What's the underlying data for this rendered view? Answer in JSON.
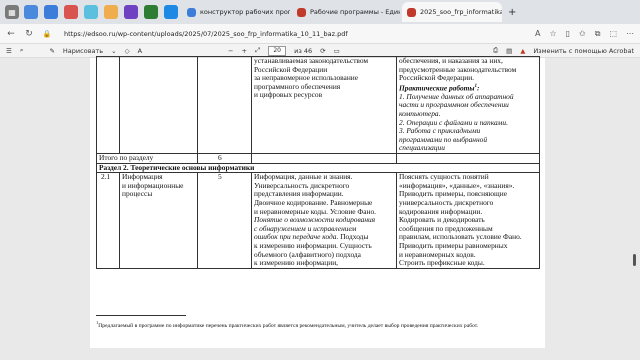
{
  "browser": {
    "tabs": [
      {
        "title": "конструктор рабочих программ"
      },
      {
        "title": "Рабочие программы - Единое"
      },
      {
        "title": "2025_soo_frp_informatika_10_11..."
      }
    ],
    "url": "https://edsoo.ru/wp-content/uploads/2025/07/2025_soo_frp_informatika_10_11_baz.pdf"
  },
  "pdf_toolbar": {
    "draw_label": "Нарисовать",
    "page_current": "20",
    "page_total": "из 46",
    "acrobat_label": "Изменить с помощью Acrobat"
  },
  "table": {
    "r1_c3": [
      "устанавливаемая законодательством",
      "Российской Федерации",
      "за неправомерное использование",
      "программного обеспечения",
      "и цифровых ресурсов"
    ],
    "r1_c4_top": [
      "обеспечения, и наказания за них,",
      "предусмотренные законодательством",
      "Российской Федерации."
    ],
    "practice_heading": "Практические работы",
    "practice_sup": "1",
    "practice_items": [
      "1. Получение данных об аппаратной",
      "части и программном обеспечении",
      "компьютера.",
      "2. Операции с файлами и папками.",
      "3. Работа с прикладными",
      "программами по выбранной",
      "специализации"
    ],
    "total_label": "Итого по разделу",
    "total_value": "6",
    "section_title": "Раздел 2. Теоретические основы информатики",
    "r3_num": "2.1",
    "r3_topic": [
      "Информация",
      "и информационные",
      "процессы"
    ],
    "r3_hours": "5",
    "r3_content_a": [
      "Информация, данные и знания.",
      "Универсальность дискретного",
      "представления информации.",
      "Двоичное кодирование. Равномерные",
      "и неравномерные коды. Условие Фано."
    ],
    "r3_content_b": [
      "Понятие о возможности кодирования",
      "с обнаружением и исправлением",
      "ошибок при передаче кода."
    ],
    "r3_content_c": [
      "Подходы",
      "к измерению информации. Сущность",
      "объемного (алфавитного) подхода",
      "к измерению информации,"
    ],
    "r3_activity": [
      "Пояснять сущность понятий",
      "«информация», «данные», «знания».",
      "Приводить примеры, поясняющие",
      "универсальность дискретного",
      "кодирования информации.",
      "Кодировать и декодировать",
      "сообщения по предложенным",
      "правилам, использовать условие Фано.",
      "Приводить примеры равномерных",
      "и неравномерных кодов.",
      "Строить префиксные коды."
    ]
  },
  "footnote": "Предлагаемый в программе по информатике перечень практических работ является рекомендательным, учитель делает выбор проведения практических работ.",
  "footnote_mark": "1"
}
